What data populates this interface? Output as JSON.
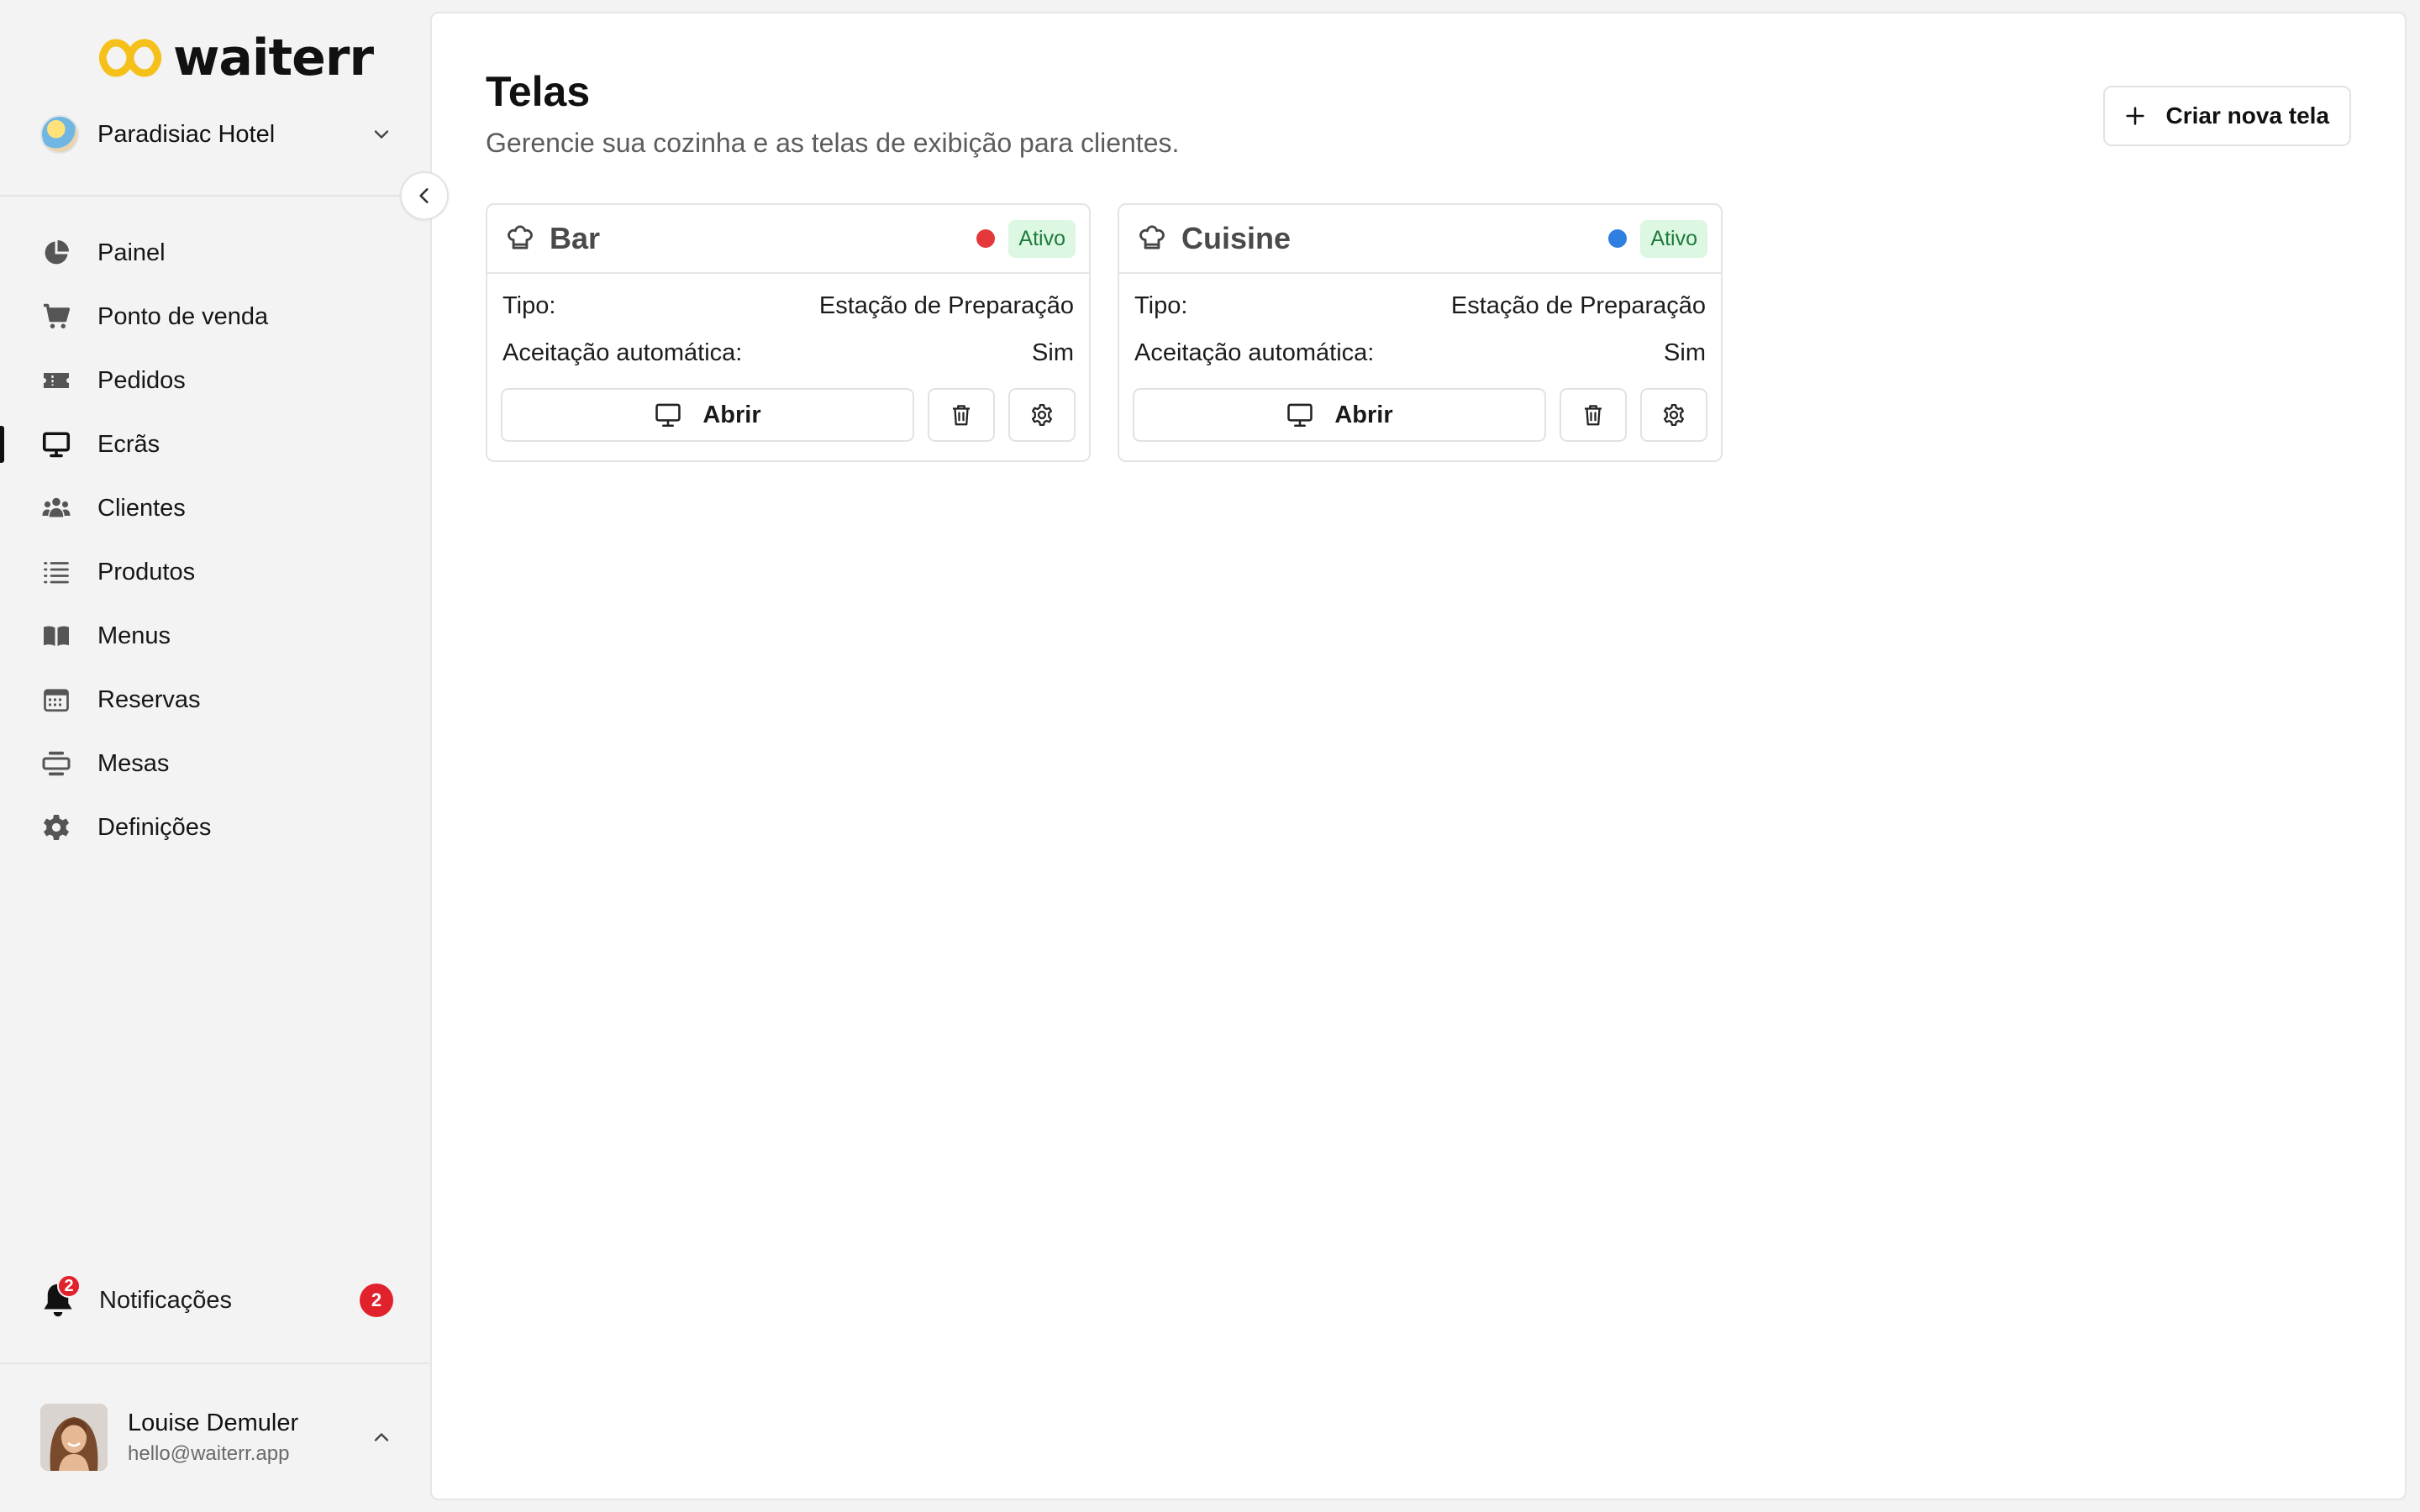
{
  "brand": {
    "name": "waiterr"
  },
  "organization": {
    "name": "Paradisiac Hotel"
  },
  "nav": {
    "items": [
      {
        "label": "Painel",
        "icon": "pie-chart-icon"
      },
      {
        "label": "Ponto de venda",
        "icon": "cart-icon"
      },
      {
        "label": "Pedidos",
        "icon": "ticket-icon"
      },
      {
        "label": "Ecrãs",
        "icon": "monitor-icon",
        "active": true
      },
      {
        "label": "Clientes",
        "icon": "users-icon"
      },
      {
        "label": "Produtos",
        "icon": "list-icon"
      },
      {
        "label": "Menus",
        "icon": "book-icon"
      },
      {
        "label": "Reservas",
        "icon": "calendar-icon"
      },
      {
        "label": "Mesas",
        "icon": "table-icon"
      },
      {
        "label": "Definições",
        "icon": "gear-icon"
      }
    ]
  },
  "notifications": {
    "label": "Notificações",
    "count": "2",
    "bell_count": "2"
  },
  "user": {
    "name": "Louise Demuler",
    "email": "hello@waiterr.app"
  },
  "page": {
    "title": "Telas",
    "subtitle": "Gerencie sua cozinha e as telas de exibição para clientes.",
    "create_label": "Criar nova tela"
  },
  "screens": [
    {
      "name": "Bar",
      "status": "Ativo",
      "color": "#e5383b",
      "type_label": "Tipo:",
      "type_value": "Estação de Preparação",
      "auto_label": "Aceitação automática:",
      "auto_value": "Sim",
      "open_label": "Abrir"
    },
    {
      "name": "Cuisine",
      "status": "Ativo",
      "color": "#2f7fe0",
      "type_label": "Tipo:",
      "type_value": "Estação de Preparação",
      "auto_label": "Aceitação automática:",
      "auto_value": "Sim",
      "open_label": "Abrir"
    }
  ],
  "colors": {
    "badge_bg": "#dcf7e2",
    "badge_text": "#1f7a3d",
    "alert": "#e1222c",
    "logo_yellow": "#f6c01b"
  }
}
